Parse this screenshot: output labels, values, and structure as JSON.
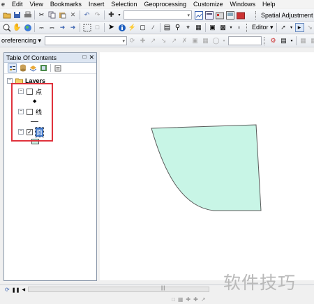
{
  "menu": [
    "e",
    "Edit",
    "View",
    "Bookmarks",
    "Insert",
    "Selection",
    "Geoprocessing",
    "Customize",
    "Windows",
    "Help"
  ],
  "toolbar1": {
    "spatial_adjustment": "Spatial Adjustment"
  },
  "toolbar2": {
    "editor": "Editor ▾"
  },
  "toolbar3": {
    "georeferencing": "oreferencing ▾"
  },
  "toc": {
    "title": "Table Of Contents",
    "root": "Layers",
    "layers": [
      {
        "name": "点",
        "checked": false,
        "symbol": "point"
      },
      {
        "name": "线",
        "checked": false,
        "symbol": "line"
      },
      {
        "name": "面",
        "checked": true,
        "symbol": "polygon"
      }
    ]
  },
  "colors": {
    "polygon_fill": "#c8f5e6",
    "polygon_stroke": "#5a5a5a",
    "highlight_box": "#e0323c",
    "toc_header": "#dde6f2"
  },
  "icons": [
    "new-icon",
    "open-icon",
    "save-icon",
    "print-icon",
    "cut-icon",
    "copy-icon",
    "paste-icon",
    "delete-icon",
    "undo-icon",
    "redo-icon",
    "add-data-icon",
    "zoom-in-icon",
    "pan-icon",
    "full-extent-icon",
    "select-icon",
    "identify-icon",
    "find-icon",
    "sketch-tool-icon",
    "edit-tool-icon"
  ],
  "watermark": "软件技巧"
}
